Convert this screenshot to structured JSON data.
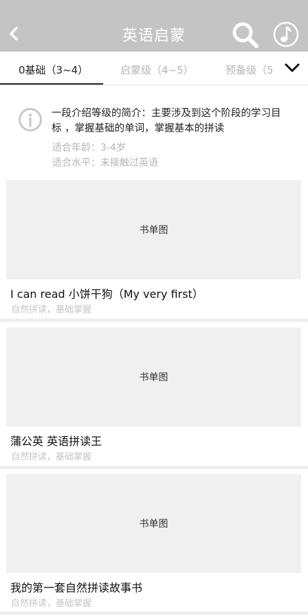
{
  "header": {
    "title": "英语启蒙",
    "back_icon": "chevron-left-icon",
    "search_icon": "search-icon",
    "music_icon": "music-note-icon",
    "background": "#c4c4c4"
  },
  "tabs": {
    "items": [
      {
        "label": "0基础（3~4）",
        "active": true
      },
      {
        "label": "启蒙级（4~5）",
        "active": false
      },
      {
        "label": "预备级（5",
        "active": false
      }
    ],
    "more_icon": "chevron-down-icon"
  },
  "intro": {
    "icon": "info-icon",
    "description": "一段介绍等级的简介：主要涉及到这个阶段的学习目标 ，掌握基础的单词，掌握基本的拼读",
    "age": "适合年龄：3-4岁",
    "level": "适合水平：未接触过英语"
  },
  "books": [
    {
      "cover_label": "书单图",
      "title": "I can read 小饼干狗（My very first）",
      "subtitle": "自然拼读，基础掌握"
    },
    {
      "cover_label": "书单图",
      "title": "蒲公英 英语拼读王",
      "subtitle": "自然拼读，基础掌握"
    },
    {
      "cover_label": "书单图",
      "title": "我的第一套自然拼读故事书",
      "subtitle": "自然拼读，基础掌握"
    }
  ]
}
